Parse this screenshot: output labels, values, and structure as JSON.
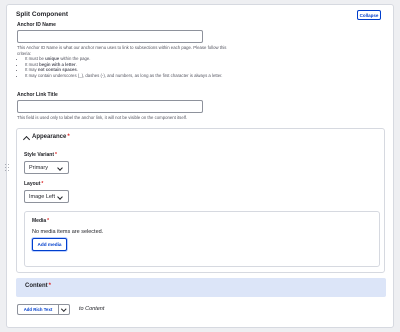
{
  "component": {
    "title": "Split Component",
    "collapse_label": "Collapse"
  },
  "anchor_id": {
    "label": "Anchor ID Name",
    "value": "",
    "help_intro": "This Anchor ID Name is what our anchor menu uses to link to subsections within each page. Please follow this criteria:",
    "rules": [
      {
        "pre": "It must be ",
        "strong": "unique",
        "post": " within the page."
      },
      {
        "pre": "It must ",
        "strong": "begin with a letter",
        "post": "."
      },
      {
        "pre": "It may ",
        "strong": "not contain spaces",
        "post": "."
      },
      {
        "pre": "It may contain underscores (_), dashes (-), and numbers, as long as the first character is always a letter.",
        "strong": "",
        "post": ""
      }
    ]
  },
  "anchor_link": {
    "label": "Anchor Link Title",
    "value": "",
    "help": "This field is used only to label the anchor link, it will not be visible on the component itself."
  },
  "appearance": {
    "title": "Appearance",
    "style_variant": {
      "label": "Style Variant",
      "value": "Primary"
    },
    "layout": {
      "label": "Layout",
      "value": "Image Left"
    },
    "media": {
      "label": "Media",
      "empty_text": "No media items are selected.",
      "add_label": "Add media"
    }
  },
  "content": {
    "title": "Content",
    "add_button_label": "Add Rich Text",
    "to_label": "to Content"
  },
  "required_marker": "*",
  "colors": {
    "accent": "#003ecc",
    "required": "#dc2323",
    "content_bar": "#dce5f8",
    "page_bg": "#eeeff2"
  }
}
